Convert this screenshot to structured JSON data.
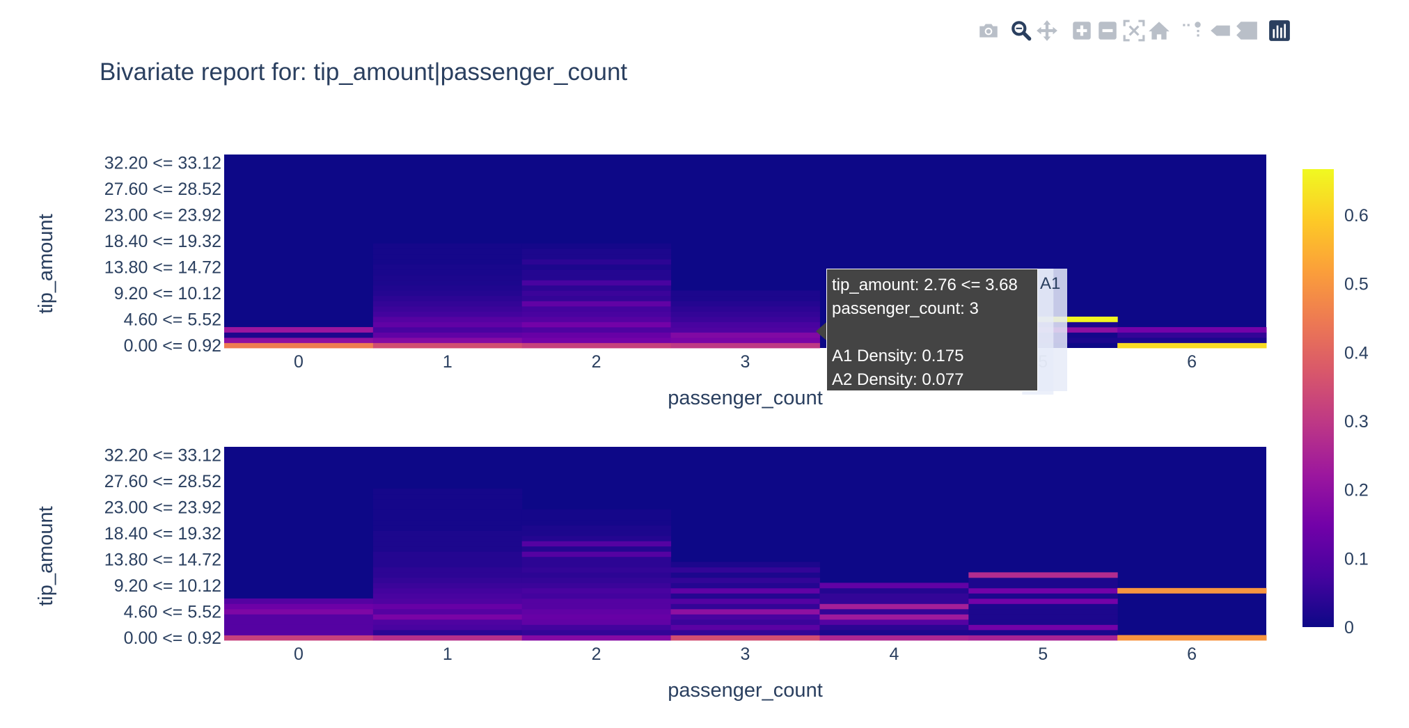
{
  "modebar": {
    "icons": [
      "camera-icon",
      "zoom-icon",
      "pan-icon",
      "zoom-in-icon",
      "zoom-out-icon",
      "autoscale-icon",
      "home-icon",
      "spike-lines-icon",
      "hover-closest-icon",
      "hover-compare-icon",
      "plotly-logo-icon"
    ],
    "active_color": "#2a3f5f",
    "inactive_color": "#b9bfc8"
  },
  "title": "Bivariate report for: tip_amount|passenger_count",
  "tooltip": {
    "line1": "tip_amount: 2.76 <= 3.68",
    "line2": "passenger_count: 3",
    "line3": "A1 Density: 0.175",
    "line4": "A2 Density: 0.077",
    "tag": "A1",
    "bg": "#444444"
  },
  "colors": {
    "background": "#ffffff",
    "heat_bg": "#0d0887",
    "text": "#2a3f5f",
    "colorscale": [
      "#0d0887",
      "#46039f",
      "#7201a8",
      "#9c179e",
      "#bd3786",
      "#d8576b",
      "#ed7953",
      "#fb9f3a",
      "#fdca26",
      "#f0f921"
    ]
  },
  "chart_data": {
    "type": "heatmap",
    "xlabel": "passenger_count",
    "ylabel": "tip_amount",
    "x_ticks": [
      "0",
      "1",
      "2",
      "3",
      "4",
      "5",
      "6"
    ],
    "y_ticks": [
      "32.20 <= 33.12",
      "27.60 <= 28.52",
      "23.00 <= 23.92",
      "18.40 <= 19.32",
      "13.80 <= 14.72",
      "9.20 <= 10.12",
      "4.60 <= 5.52",
      "0.00 <= 0.92"
    ],
    "y_bins_count": 37,
    "y_bin_width": 0.92,
    "colorbar": {
      "min": 0,
      "max": 0.667,
      "ticks": [
        "0",
        "0.1",
        "0.2",
        "0.3",
        "0.4",
        "0.5",
        "0.6"
      ]
    },
    "panels": [
      {
        "name": "A1",
        "columns": [
          {
            "x": "0",
            "cells": [
              [
                0,
                0.45
              ],
              [
                1,
                0.2
              ],
              [
                2,
                0.02
              ],
              [
                3,
                0.22
              ]
            ]
          },
          {
            "x": "1",
            "cells": [
              [
                0,
                0.35
              ],
              [
                1,
                0.18
              ],
              [
                2,
                0.12
              ],
              [
                3,
                0.08
              ],
              [
                4,
                0.12
              ],
              [
                5,
                0.1
              ],
              [
                6,
                0.07
              ],
              [
                7,
                0.06
              ],
              [
                8,
                0.05
              ],
              [
                9,
                0.04
              ],
              [
                10,
                0.03
              ],
              [
                11,
                0.025
              ],
              [
                12,
                0.02
              ],
              [
                13,
                0.02
              ],
              [
                14,
                0.015
              ],
              [
                15,
                0.015
              ],
              [
                16,
                0.01
              ],
              [
                17,
                0.01
              ],
              [
                18,
                0.01
              ],
              [
                19,
                0.01
              ]
            ]
          },
          {
            "x": "2",
            "cells": [
              [
                0,
                0.32
              ],
              [
                1,
                0.15
              ],
              [
                2,
                0.13
              ],
              [
                3,
                0.09
              ],
              [
                4,
                0.15
              ],
              [
                5,
                0.1
              ],
              [
                6,
                0.08
              ],
              [
                7,
                0.07
              ],
              [
                8,
                0.12
              ],
              [
                9,
                0.05
              ],
              [
                10,
                0.06
              ],
              [
                11,
                0.04
              ],
              [
                12,
                0.08
              ],
              [
                13,
                0.03
              ],
              [
                14,
                0.03
              ],
              [
                15,
                0.02
              ],
              [
                16,
                0.04
              ],
              [
                17,
                0.02
              ],
              [
                18,
                0.02
              ],
              [
                19,
                0.01
              ]
            ]
          },
          {
            "x": "3",
            "cells": [
              [
                0,
                0.3
              ],
              [
                1,
                0.16
              ],
              [
                2,
                0.175
              ],
              [
                3,
                0.09
              ],
              [
                4,
                0.08
              ],
              [
                5,
                0.06
              ],
              [
                6,
                0.05
              ],
              [
                7,
                0.04
              ],
              [
                8,
                0.03
              ],
              [
                9,
                0.02
              ],
              [
                10,
                0.02
              ]
            ]
          },
          {
            "x": "4",
            "cells": []
          },
          {
            "x": "5",
            "cells": [
              [
                1,
                0.02
              ],
              [
                2,
                0.01
              ],
              [
                3,
                0.2
              ],
              [
                4,
                0.02
              ],
              [
                5,
                0.66
              ]
            ]
          },
          {
            "x": "6",
            "cells": [
              [
                0,
                0.62
              ],
              [
                1,
                0.02
              ],
              [
                2,
                0.05
              ],
              [
                3,
                0.15
              ]
            ]
          }
        ]
      },
      {
        "name": "A2",
        "columns": [
          {
            "x": "0",
            "cells": [
              [
                0,
                0.32
              ],
              [
                1,
                0.1
              ],
              [
                2,
                0.1
              ],
              [
                3,
                0.1
              ],
              [
                4,
                0.1
              ],
              [
                5,
                0.17
              ],
              [
                6,
                0.14
              ],
              [
                7,
                0.1
              ]
            ]
          },
          {
            "x": "1",
            "cells": [
              [
                0,
                0.28
              ],
              [
                1,
                0.04
              ],
              [
                2,
                0.08
              ],
              [
                3,
                0.09
              ],
              [
                4,
                0.16
              ],
              [
                5,
                0.1
              ],
              [
                6,
                0.13
              ],
              [
                7,
                0.09
              ],
              [
                8,
                0.08
              ],
              [
                9,
                0.07
              ],
              [
                10,
                0.06
              ],
              [
                11,
                0.05
              ],
              [
                12,
                0.04
              ],
              [
                13,
                0.04
              ],
              [
                14,
                0.03
              ],
              [
                15,
                0.03
              ],
              [
                16,
                0.03
              ],
              [
                17,
                0.02
              ],
              [
                18,
                0.02
              ],
              [
                19,
                0.02
              ],
              [
                20,
                0.02
              ],
              [
                21,
                0.01
              ],
              [
                22,
                0.01
              ],
              [
                23,
                0.01
              ],
              [
                24,
                0.01
              ],
              [
                25,
                0.01
              ],
              [
                26,
                0.01
              ],
              [
                27,
                0.01
              ],
              [
                28,
                0.01
              ]
            ]
          },
          {
            "x": "2",
            "cells": [
              [
                0,
                0.18
              ],
              [
                1,
                0.05
              ],
              [
                2,
                0.07
              ],
              [
                3,
                0.12
              ],
              [
                4,
                0.13
              ],
              [
                5,
                0.12
              ],
              [
                6,
                0.1
              ],
              [
                7,
                0.1
              ],
              [
                8,
                0.07
              ],
              [
                9,
                0.08
              ],
              [
                10,
                0.06
              ],
              [
                11,
                0.05
              ],
              [
                12,
                0.04
              ],
              [
                13,
                0.05
              ],
              [
                14,
                0.04
              ],
              [
                15,
                0.04
              ],
              [
                16,
                0.1
              ],
              [
                17,
                0.03
              ],
              [
                18,
                0.1
              ],
              [
                19,
                0.03
              ],
              [
                20,
                0.02
              ],
              [
                21,
                0.02
              ],
              [
                22,
                0.01
              ],
              [
                23,
                0.01
              ],
              [
                24,
                0.01
              ]
            ]
          },
          {
            "x": "3",
            "cells": [
              [
                0,
                0.35
              ],
              [
                1,
                0.05
              ],
              [
                2,
                0.11
              ],
              [
                3,
                0.06
              ],
              [
                4,
                0.08
              ],
              [
                5,
                0.2
              ],
              [
                6,
                0.05
              ],
              [
                7,
                0.1
              ],
              [
                8,
                0.03
              ],
              [
                9,
                0.12
              ],
              [
                10,
                0.03
              ],
              [
                11,
                0.05
              ],
              [
                12,
                0.02
              ],
              [
                13,
                0.05
              ],
              [
                14,
                0.02
              ]
            ]
          },
          {
            "x": "4",
            "cells": [
              [
                0,
                0.26
              ],
              [
                1,
                0.02
              ],
              [
                2,
                0.04
              ],
              [
                3,
                0.1
              ],
              [
                4,
                0.23
              ],
              [
                5,
                0.05
              ],
              [
                6,
                0.24
              ],
              [
                7,
                0.05
              ],
              [
                8,
                0.05
              ],
              [
                9,
                0.03
              ],
              [
                10,
                0.12
              ]
            ]
          },
          {
            "x": "5",
            "cells": [
              [
                0,
                0.25
              ],
              [
                1,
                0.02
              ],
              [
                2,
                0.15
              ],
              [
                3,
                0.02
              ],
              [
                4,
                0.02
              ],
              [
                5,
                0.02
              ],
              [
                6,
                0.02
              ],
              [
                7,
                0.15
              ],
              [
                8,
                0.02
              ],
              [
                9,
                0.15
              ],
              [
                10,
                0.02
              ],
              [
                11,
                0.02
              ],
              [
                12,
                0.27
              ]
            ]
          },
          {
            "x": "6",
            "cells": [
              [
                0,
                0.5
              ],
              [
                9,
                0.5
              ]
            ]
          }
        ]
      }
    ],
    "hover_highlight": {
      "panel": "A1",
      "x": "5"
    }
  }
}
